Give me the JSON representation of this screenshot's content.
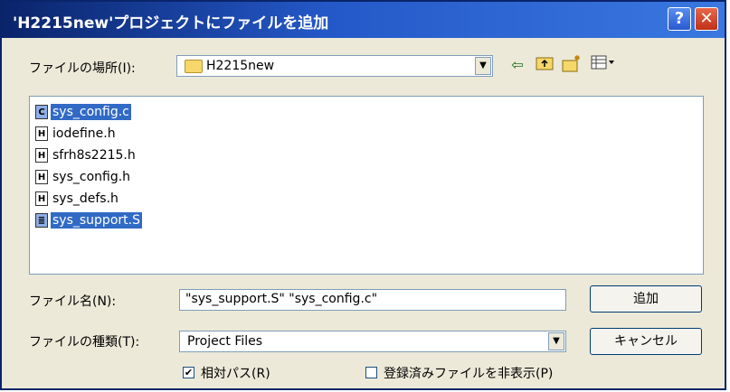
{
  "window": {
    "title": "'H2215new'プロジェクトにファイルを追加",
    "help_label": "?",
    "close_label": "✕"
  },
  "look_in": {
    "label": "ファイルの場所(I):",
    "value": "H2215new"
  },
  "toolbar": {
    "back_icon": "back-arrow-icon",
    "up_icon": "up-folder-icon",
    "new_folder_icon": "new-folder-icon",
    "view_icon": "view-menu-icon"
  },
  "files": [
    {
      "name": "sys_config.c",
      "icon": "C",
      "selected": true
    },
    {
      "name": "iodefine.h",
      "icon": "H",
      "selected": false
    },
    {
      "name": "sfrh8s2215.h",
      "icon": "H",
      "selected": false
    },
    {
      "name": "sys_config.h",
      "icon": "H",
      "selected": false
    },
    {
      "name": "sys_defs.h",
      "icon": "H",
      "selected": false
    },
    {
      "name": "sys_support.S",
      "icon": "≣",
      "selected": true
    }
  ],
  "filename": {
    "label": "ファイル名(N):",
    "value": "\"sys_support.S\" \"sys_config.c\""
  },
  "filetype": {
    "label": "ファイルの種類(T):",
    "value": "Project Files"
  },
  "buttons": {
    "add": "追加",
    "cancel": "キャンセル"
  },
  "options": {
    "relative_path": {
      "label": "相対パス(R)",
      "checked": true
    },
    "hide_registered": {
      "label": "登録済みファイルを非表示(P)",
      "checked": false
    }
  }
}
